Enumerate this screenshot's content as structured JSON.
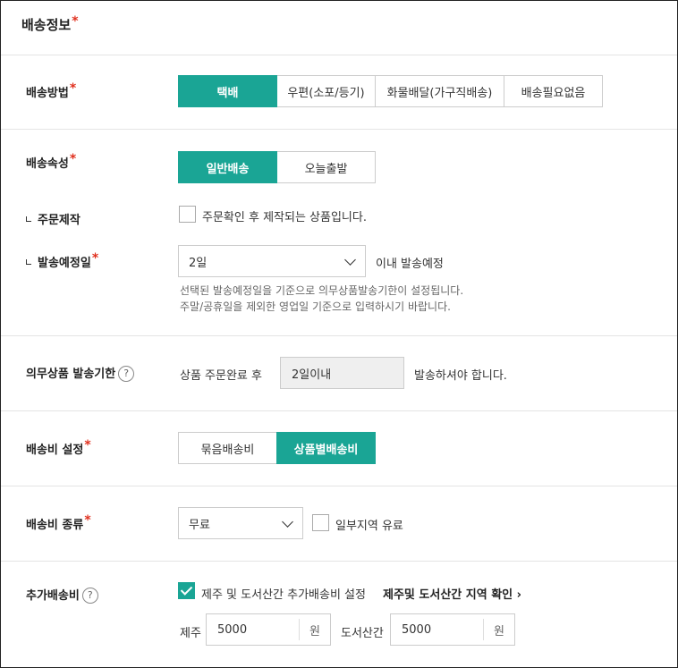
{
  "section_title": "배송정보",
  "shipping_method": {
    "label": "배송방법",
    "options": [
      "택배",
      "우편(소포/등기)",
      "화물배달(가구직배송)",
      "배송필요없음"
    ],
    "selected": "택배"
  },
  "shipping_type": {
    "label": "배송속성",
    "options": [
      "일반배송",
      "오늘출발"
    ],
    "selected": "일반배송"
  },
  "custom_order": {
    "label": "주문제작",
    "checkbox_label": "주문확인 후 제작되는 상품입니다.",
    "checked": false
  },
  "dispatch_date": {
    "label": "발송예정일",
    "selected_value": "2일",
    "suffix": "이내 발송예정",
    "help_line1": "선택된 발송예정일을 기준으로 의무상품발송기한이 설정됩니다.",
    "help_line2": "주말/공휴일을 제외한 영업일 기준으로 입력하시기 바랍니다."
  },
  "mandatory_deadline": {
    "label": "의무상품 발송기한",
    "help_icon": "?",
    "prefix": "상품 주문완료 후",
    "value": "2일이내",
    "suffix": "발송하셔야 합니다."
  },
  "shipping_fee_setting": {
    "label": "배송비 설정",
    "options": [
      "묶음배송비",
      "상품별배송비"
    ],
    "selected": "상품별배송비"
  },
  "shipping_fee_type": {
    "label": "배송비 종류",
    "selected_value": "무료",
    "checkbox_label": "일부지역 유료",
    "checked": false
  },
  "extra_fee": {
    "label": "추가배송비",
    "help_icon": "?",
    "checkbox_label": "제주 및 도서산간 추가배송비 설정",
    "checked": true,
    "link_label": "제주및 도서산간 지역 확인",
    "link_arrow": "›",
    "jeju_label": "제주",
    "jeju_value": "5000",
    "jeju_unit": "원",
    "island_label": "도서산간",
    "island_value": "5000",
    "island_unit": "원"
  },
  "required_mark": "*",
  "colors": {
    "accent": "#1aa595",
    "required": "#e0301e"
  }
}
